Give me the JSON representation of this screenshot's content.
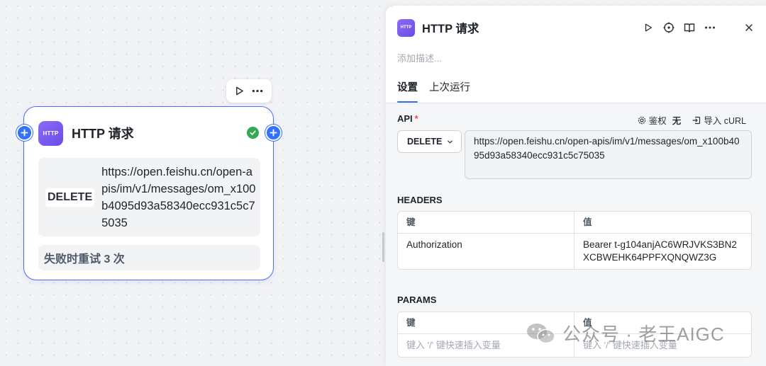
{
  "node": {
    "title": "HTTP 请求",
    "badge": "HTTP",
    "method": "DELETE",
    "url": "https://open.feishu.cn/open-apis/im/v1/messages/om_x100b4095d93a58340ecc931c5c75035",
    "retry": "失败时重试 3 次"
  },
  "panel": {
    "badge": "HTTP",
    "title": "HTTP 请求",
    "description_placeholder": "添加描述...",
    "tabs": [
      "设置",
      "上次运行"
    ],
    "api": {
      "label": "API",
      "required_mark": "*",
      "auth_label": "鉴权",
      "auth_value": "无",
      "import_label": "导入 cURL",
      "method": "DELETE",
      "url": "https://open.feishu.cn/open-apis/im/v1/messages/om_x100b4095d93a58340ecc931c5c75035"
    },
    "headers": {
      "label": "HEADERS",
      "col_key": "键",
      "col_value": "值",
      "rows": [
        {
          "key": "Authorization",
          "value": "Bearer t-g104anjAC6WRJVKS3BN2XCBWEHK64PPFXQNQWZ3G"
        }
      ]
    },
    "params": {
      "label": "PARAMS",
      "col_key": "键",
      "col_value": "值",
      "key_placeholder": "键入 '/' 键快速插入变量",
      "value_placeholder": "键入 '/' 键快速插入变量"
    }
  },
  "watermark": "公众号 · 老王AIGC",
  "colors": {
    "accent": "#3370ff",
    "node_border": "#4d6bfe",
    "badge": "#7b5cf0",
    "success": "#34a853",
    "required": "#f54a45"
  }
}
